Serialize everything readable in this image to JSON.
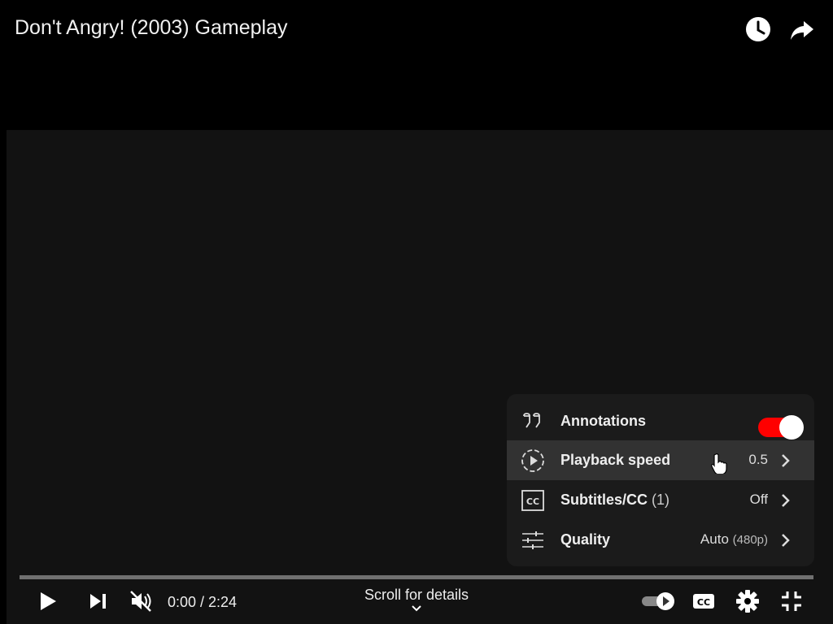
{
  "video": {
    "title": "Don't Angry! (2003) Gameplay"
  },
  "header": {
    "icons": [
      "watch-later-icon",
      "share-icon"
    ]
  },
  "settings_menu": {
    "items": [
      {
        "label": "Annotations",
        "icon": "annotations-icon",
        "toggle_on": true
      },
      {
        "label": "Playback speed",
        "icon": "playback-speed-icon",
        "value": "0.5"
      },
      {
        "label": "Subtitles/CC",
        "count": "(1)",
        "icon": "cc-icon",
        "value": "Off"
      },
      {
        "label": "Quality",
        "icon": "quality-sliders-icon",
        "value": "Auto",
        "value_detail": "(480p)"
      }
    ]
  },
  "controls": {
    "time": "0:00 / 2:24",
    "scroll_hint": "Scroll for details",
    "autoplay_on": true,
    "left_icons": [
      "play-icon",
      "next-icon",
      "mute-icon"
    ],
    "right_icons": [
      "autoplay-toggle-icon",
      "subtitles-icon",
      "settings-gear-icon",
      "exit-fullscreen-icon"
    ]
  },
  "colors": {
    "accent": "#ff0000",
    "menu_bg": "#1c1c1c",
    "video_bg": "#121212"
  }
}
